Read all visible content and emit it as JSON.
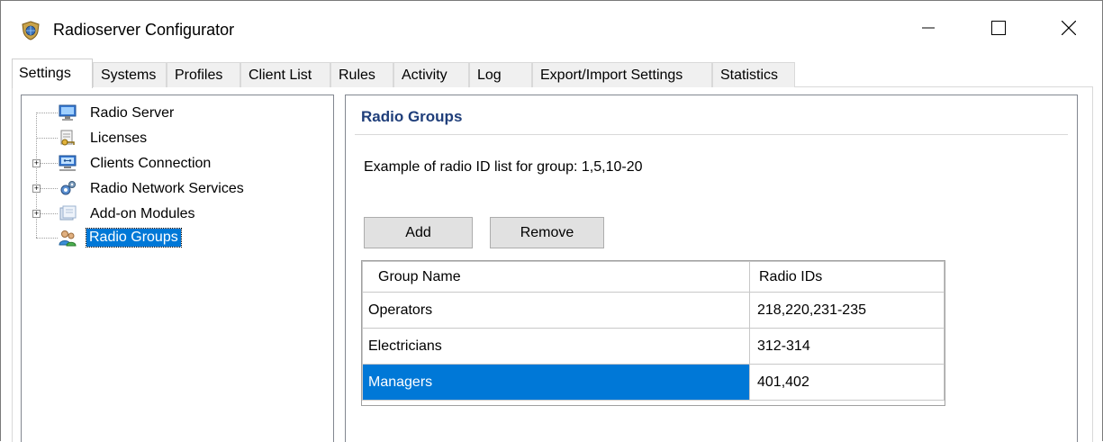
{
  "window": {
    "title": "Radioserver Configurator",
    "app_icon": "shield-globe-icon",
    "controls": [
      "minimize-icon",
      "maximize-icon",
      "close-icon"
    ]
  },
  "tabs": [
    {
      "label": "Settings",
      "active": true
    },
    {
      "label": "Systems"
    },
    {
      "label": "Profiles"
    },
    {
      "label": "Client List"
    },
    {
      "label": "Rules"
    },
    {
      "label": "Activity"
    },
    {
      "label": "Log"
    },
    {
      "label": "Export/Import Settings"
    },
    {
      "label": "Statistics"
    }
  ],
  "tree": {
    "items": [
      {
        "label": "Radio Server",
        "icon": "monitor-icon",
        "expandable": false
      },
      {
        "label": "Licenses",
        "icon": "license-key-icon",
        "expandable": false
      },
      {
        "label": "Clients Connection",
        "icon": "network-icon",
        "expandable": true
      },
      {
        "label": "Radio Network Services",
        "icon": "gears-icon",
        "expandable": true
      },
      {
        "label": "Add-on Modules",
        "icon": "modules-icon",
        "expandable": true
      },
      {
        "label": "Radio Groups",
        "icon": "users-group-icon",
        "expandable": false,
        "selected": true
      }
    ]
  },
  "panel": {
    "title": "Radio Groups",
    "hint": "Example of radio ID list for group: 1,5,10-20",
    "add_label": "Add",
    "remove_label": "Remove"
  },
  "grid": {
    "columns": [
      "Group Name",
      "Radio IDs"
    ],
    "rows": [
      [
        "Operators",
        "218,220,231-235"
      ],
      [
        "Electricians",
        "312-314"
      ],
      [
        "Managers",
        "401,402"
      ]
    ],
    "selected_row": 2
  },
  "colors": {
    "selection": "#0078d7",
    "panel_title": "#1f3e7a"
  }
}
